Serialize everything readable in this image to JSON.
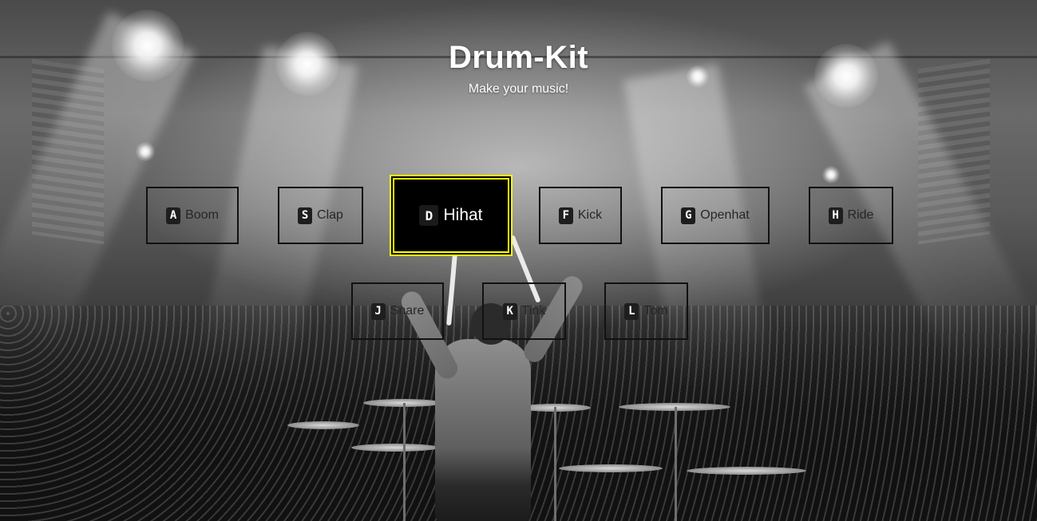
{
  "header": {
    "title": "Drum-Kit",
    "subtitle": "Make your music!"
  },
  "keys": [
    {
      "letter": "A",
      "sound": "Boom",
      "active": false
    },
    {
      "letter": "S",
      "sound": "Clap",
      "active": false
    },
    {
      "letter": "D",
      "sound": "Hihat",
      "active": true
    },
    {
      "letter": "F",
      "sound": "Kick",
      "active": false
    },
    {
      "letter": "G",
      "sound": "Openhat",
      "active": false
    },
    {
      "letter": "H",
      "sound": "Ride",
      "active": false
    },
    {
      "letter": "J",
      "sound": "Snare",
      "active": false
    },
    {
      "letter": "K",
      "sound": "Tink",
      "active": false
    },
    {
      "letter": "L",
      "sound": "Tom",
      "active": false
    }
  ],
  "theme": {
    "active_border": "#ffff00",
    "key_border": "#111111",
    "active_background": "#000000"
  },
  "background": {
    "icon": "concert-drummer-photo"
  }
}
